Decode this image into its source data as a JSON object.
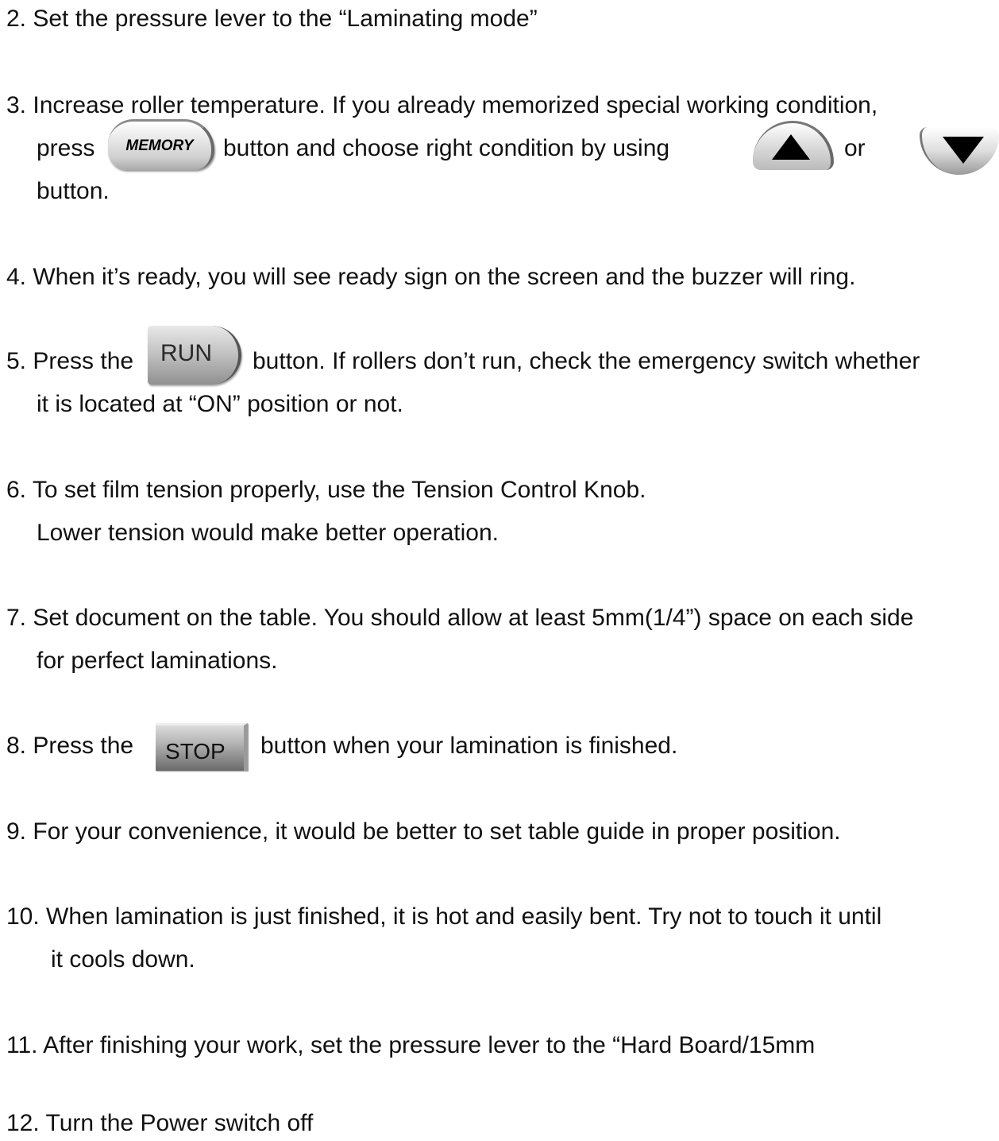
{
  "steps": {
    "s2": "2. Set the pressure lever to the “Laminating mode”",
    "s3a": "3. Increase roller temperature. If you already memorized special working condition,",
    "s3b_pre": "press",
    "s3b_mid": "button and choose right condition by using",
    "s3b_or": "or",
    "s3c": "button.",
    "s4": "4. When it’s ready, you will see ready sign on the screen and the buzzer will ring.",
    "s5a_pre": "5. Press the",
    "s5a_post": "button. If rollers don’t run, check the emergency switch whether",
    "s5b": "it is located at “ON” position or not.",
    "s6a": "6. To set film tension properly, use the Tension Control Knob.",
    "s6b": "Lower tension would make better operation.",
    "s7a": "7. Set document on the table. You should allow at least 5mm(1/4”) space on each side",
    "s7b": "for perfect laminations.",
    "s8_pre": "8. Press the",
    "s8_post": "button when your lamination is finished.",
    "s9": "9. For your convenience, it would be better to set table guide in proper position.",
    "s10a": "10. When lamination is just finished, it is hot and easily bent. Try not to touch it until",
    "s10b": "it cools down.",
    "s11": "11. After finishing your work, set the pressure lever to the “Hard Board/15mm",
    "s12": "12. Turn the Power switch off"
  },
  "buttons": {
    "memory": "MEMORY",
    "up_icon": "up-arrow-icon",
    "down_icon": "down-arrow-icon",
    "run": "RUN",
    "stop": "STOP"
  }
}
